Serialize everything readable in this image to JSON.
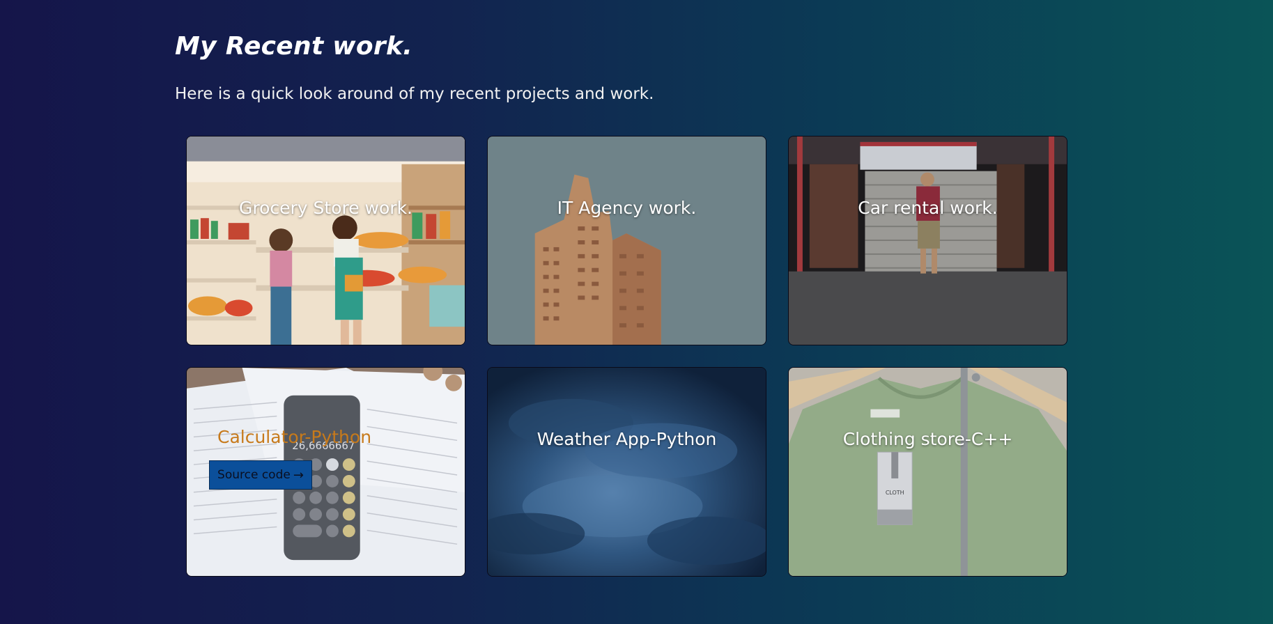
{
  "header": {
    "title": "My Recent work.",
    "subtitle": "Here is a quick look around of my recent projects and work."
  },
  "projects": [
    {
      "title": "Grocery Store work.",
      "image": "grocery-store-illustration"
    },
    {
      "title": "IT Agency work.",
      "image": "apartment-tower-photo"
    },
    {
      "title": "Car rental work.",
      "image": "garage-shutter-photo"
    },
    {
      "title": "Calculator-Python",
      "image": "phone-calculator-photo",
      "button_label": "Source code",
      "button_icon": "arrow-right-icon"
    },
    {
      "title": "Weather App-Python",
      "image": "storm-clouds-photo"
    },
    {
      "title": "Clothing store-C++",
      "image": "green-tshirt-photo"
    }
  ],
  "colors": {
    "background_start": "#15154a",
    "background_end": "#0a5457",
    "hover_title": "#c77a1b",
    "source_button": "#0b4f9a"
  }
}
